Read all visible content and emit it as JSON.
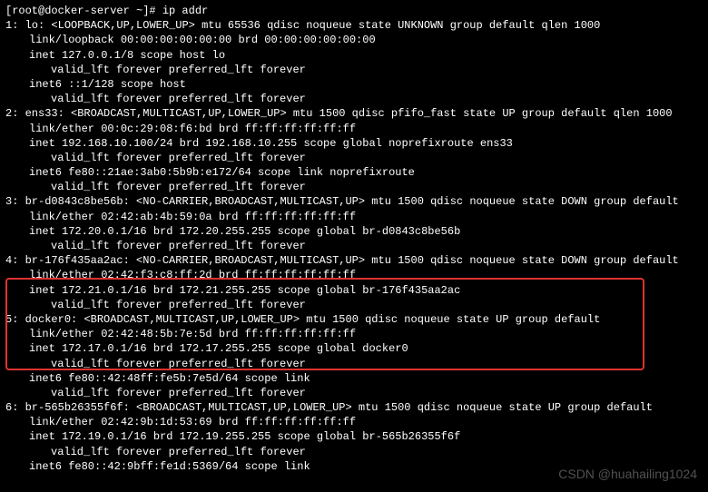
{
  "prompt": "[root@docker-server ~]# ",
  "command": "ip addr",
  "ifaces": [
    {
      "idx": "1",
      "name": "lo",
      "flags": "<LOOPBACK,UP,LOWER_UP>",
      "tail": "mtu 65536 qdisc noqueue state UNKNOWN group default qlen 1000",
      "link": "link/loopback 00:00:00:00:00:00 brd 00:00:00:00:00:00",
      "inet": "inet 127.0.0.1/8 scope host lo",
      "valid1": "valid_lft forever preferred_lft forever",
      "inet6": "inet6 ::1/128 scope host",
      "valid2": "valid_lft forever preferred_lft forever"
    },
    {
      "idx": "2",
      "name": "ens33",
      "flags": "<BROADCAST,MULTICAST,UP,LOWER_UP>",
      "tail": "mtu 1500 qdisc pfifo_fast state UP group default qlen 1000",
      "link": "link/ether 00:0c:29:08:f6:bd brd ff:ff:ff:ff:ff:ff",
      "inet": "inet 192.168.10.100/24 brd 192.168.10.255 scope global noprefixroute ens33",
      "valid1": "valid_lft forever preferred_lft forever",
      "inet6": "inet6 fe80::21ae:3ab0:5b9b:e172/64 scope link noprefixroute",
      "valid2": "valid_lft forever preferred_lft forever"
    },
    {
      "idx": "3",
      "name": "br-d0843c8be56b",
      "flags": "<NO-CARRIER,BROADCAST,MULTICAST,UP>",
      "tail": "mtu 1500 qdisc noqueue state DOWN group default",
      "link": "link/ether 02:42:ab:4b:59:0a brd ff:ff:ff:ff:ff:ff",
      "inet": "inet 172.20.0.1/16 brd 172.20.255.255 scope global br-d0843c8be56b",
      "valid1": "valid_lft forever preferred_lft forever",
      "inet6": "",
      "valid2": ""
    },
    {
      "idx": "4",
      "name": "br-176f435aa2ac",
      "flags": "<NO-CARRIER,BROADCAST,MULTICAST,UP>",
      "tail": "mtu 1500 qdisc noqueue state DOWN group default",
      "link": "link/ether 02:42:f3:c8:ff:2d brd ff:ff:ff:ff:ff:ff",
      "inet": "inet 172.21.0.1/16 brd 172.21.255.255 scope global br-176f435aa2ac",
      "valid1": "valid_lft forever preferred_lft forever",
      "inet6": "",
      "valid2": ""
    },
    {
      "idx": "5",
      "name": "docker0",
      "flags": "<BROADCAST,MULTICAST,UP,LOWER_UP>",
      "tail": "mtu 1500 qdisc noqueue state UP group default",
      "link": "link/ether 02:42:48:5b:7e:5d brd ff:ff:ff:ff:ff:ff",
      "inet": "inet 172.17.0.1/16 brd 172.17.255.255 scope global docker0",
      "valid1": "valid_lft forever preferred_lft forever",
      "inet6": "inet6 fe80::42:48ff:fe5b:7e5d/64 scope link",
      "valid2": "valid_lft forever preferred_lft forever"
    },
    {
      "idx": "6",
      "name": "br-565b26355f6f",
      "flags": "<BROADCAST,MULTICAST,UP,LOWER_UP>",
      "tail": "mtu 1500 qdisc noqueue state UP group default",
      "link": "link/ether 02:42:9b:1d:53:69 brd ff:ff:ff:ff:ff:ff",
      "inet": "inet 172.19.0.1/16 brd 172.19.255.255 scope global br-565b26355f6f",
      "valid1": "valid_lft forever preferred_lft forever",
      "inet6": "inet6 fe80::42:9bff:fe1d:5369/64 scope link",
      "valid2": ""
    }
  ],
  "highlighted_iface_idx": "5",
  "watermark": "CSDN @huahailing1024"
}
